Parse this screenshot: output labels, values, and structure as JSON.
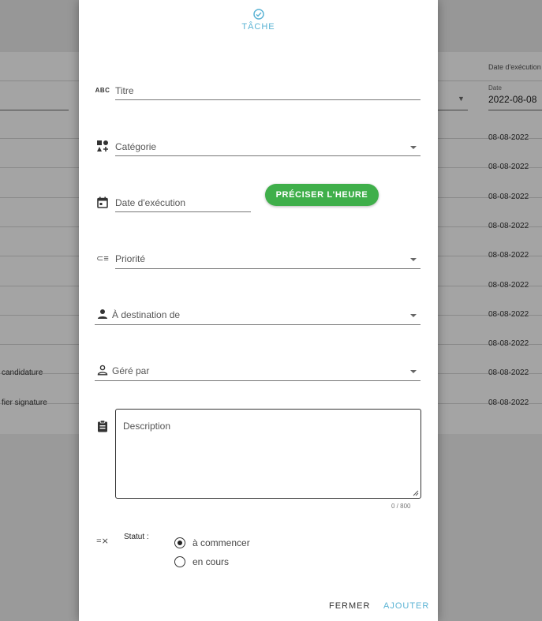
{
  "background": {
    "header_right": "Date d'exécution",
    "date_filter_label": "Date",
    "date_filter_value": "2022-08-08",
    "rows": [
      {
        "left": "",
        "date": "08-08-2022"
      },
      {
        "left": "",
        "date": "08-08-2022"
      },
      {
        "left": "",
        "date": "08-08-2022"
      },
      {
        "left": "",
        "date": "08-08-2022"
      },
      {
        "left": "",
        "date": "08-08-2022"
      },
      {
        "left": "",
        "date": "08-08-2022"
      },
      {
        "left": "",
        "date": "08-08-2022"
      },
      {
        "left": "",
        "date": "08-08-2022"
      },
      {
        "left": "candidature",
        "date": "08-08-2022"
      },
      {
        "left": "fier signature",
        "date": "08-08-2022"
      }
    ]
  },
  "dialog": {
    "title": "TÂCHE",
    "accent_color": "#5bb3d4",
    "fields": {
      "titre": {
        "icon": "abc-icon",
        "label": "Titre",
        "value": ""
      },
      "categorie": {
        "icon": "category-icon",
        "label": "Catégorie",
        "value": ""
      },
      "date": {
        "icon": "calendar-icon",
        "label": "Date d'exécution",
        "value": ""
      },
      "priorite": {
        "icon": "priority-icon",
        "label": "Priorité",
        "value": ""
      },
      "destination": {
        "icon": "person-icon",
        "label": "À destination de",
        "value": ""
      },
      "gere_par": {
        "icon": "person-outline-icon",
        "label": "Géré par",
        "value": ""
      },
      "description": {
        "icon": "clipboard-icon",
        "placeholder": "Description",
        "value": "",
        "counter": "0 / 800"
      }
    },
    "preciser_heure": "PRÉCISER L'HEURE",
    "preciser_heure_color": "#3faf4a",
    "statut": {
      "label": "Statut :",
      "options": [
        {
          "label": "à commencer",
          "checked": true
        },
        {
          "label": "en cours",
          "checked": false
        }
      ]
    },
    "actions": {
      "close": "FERMER",
      "submit": "AJOUTER"
    }
  }
}
